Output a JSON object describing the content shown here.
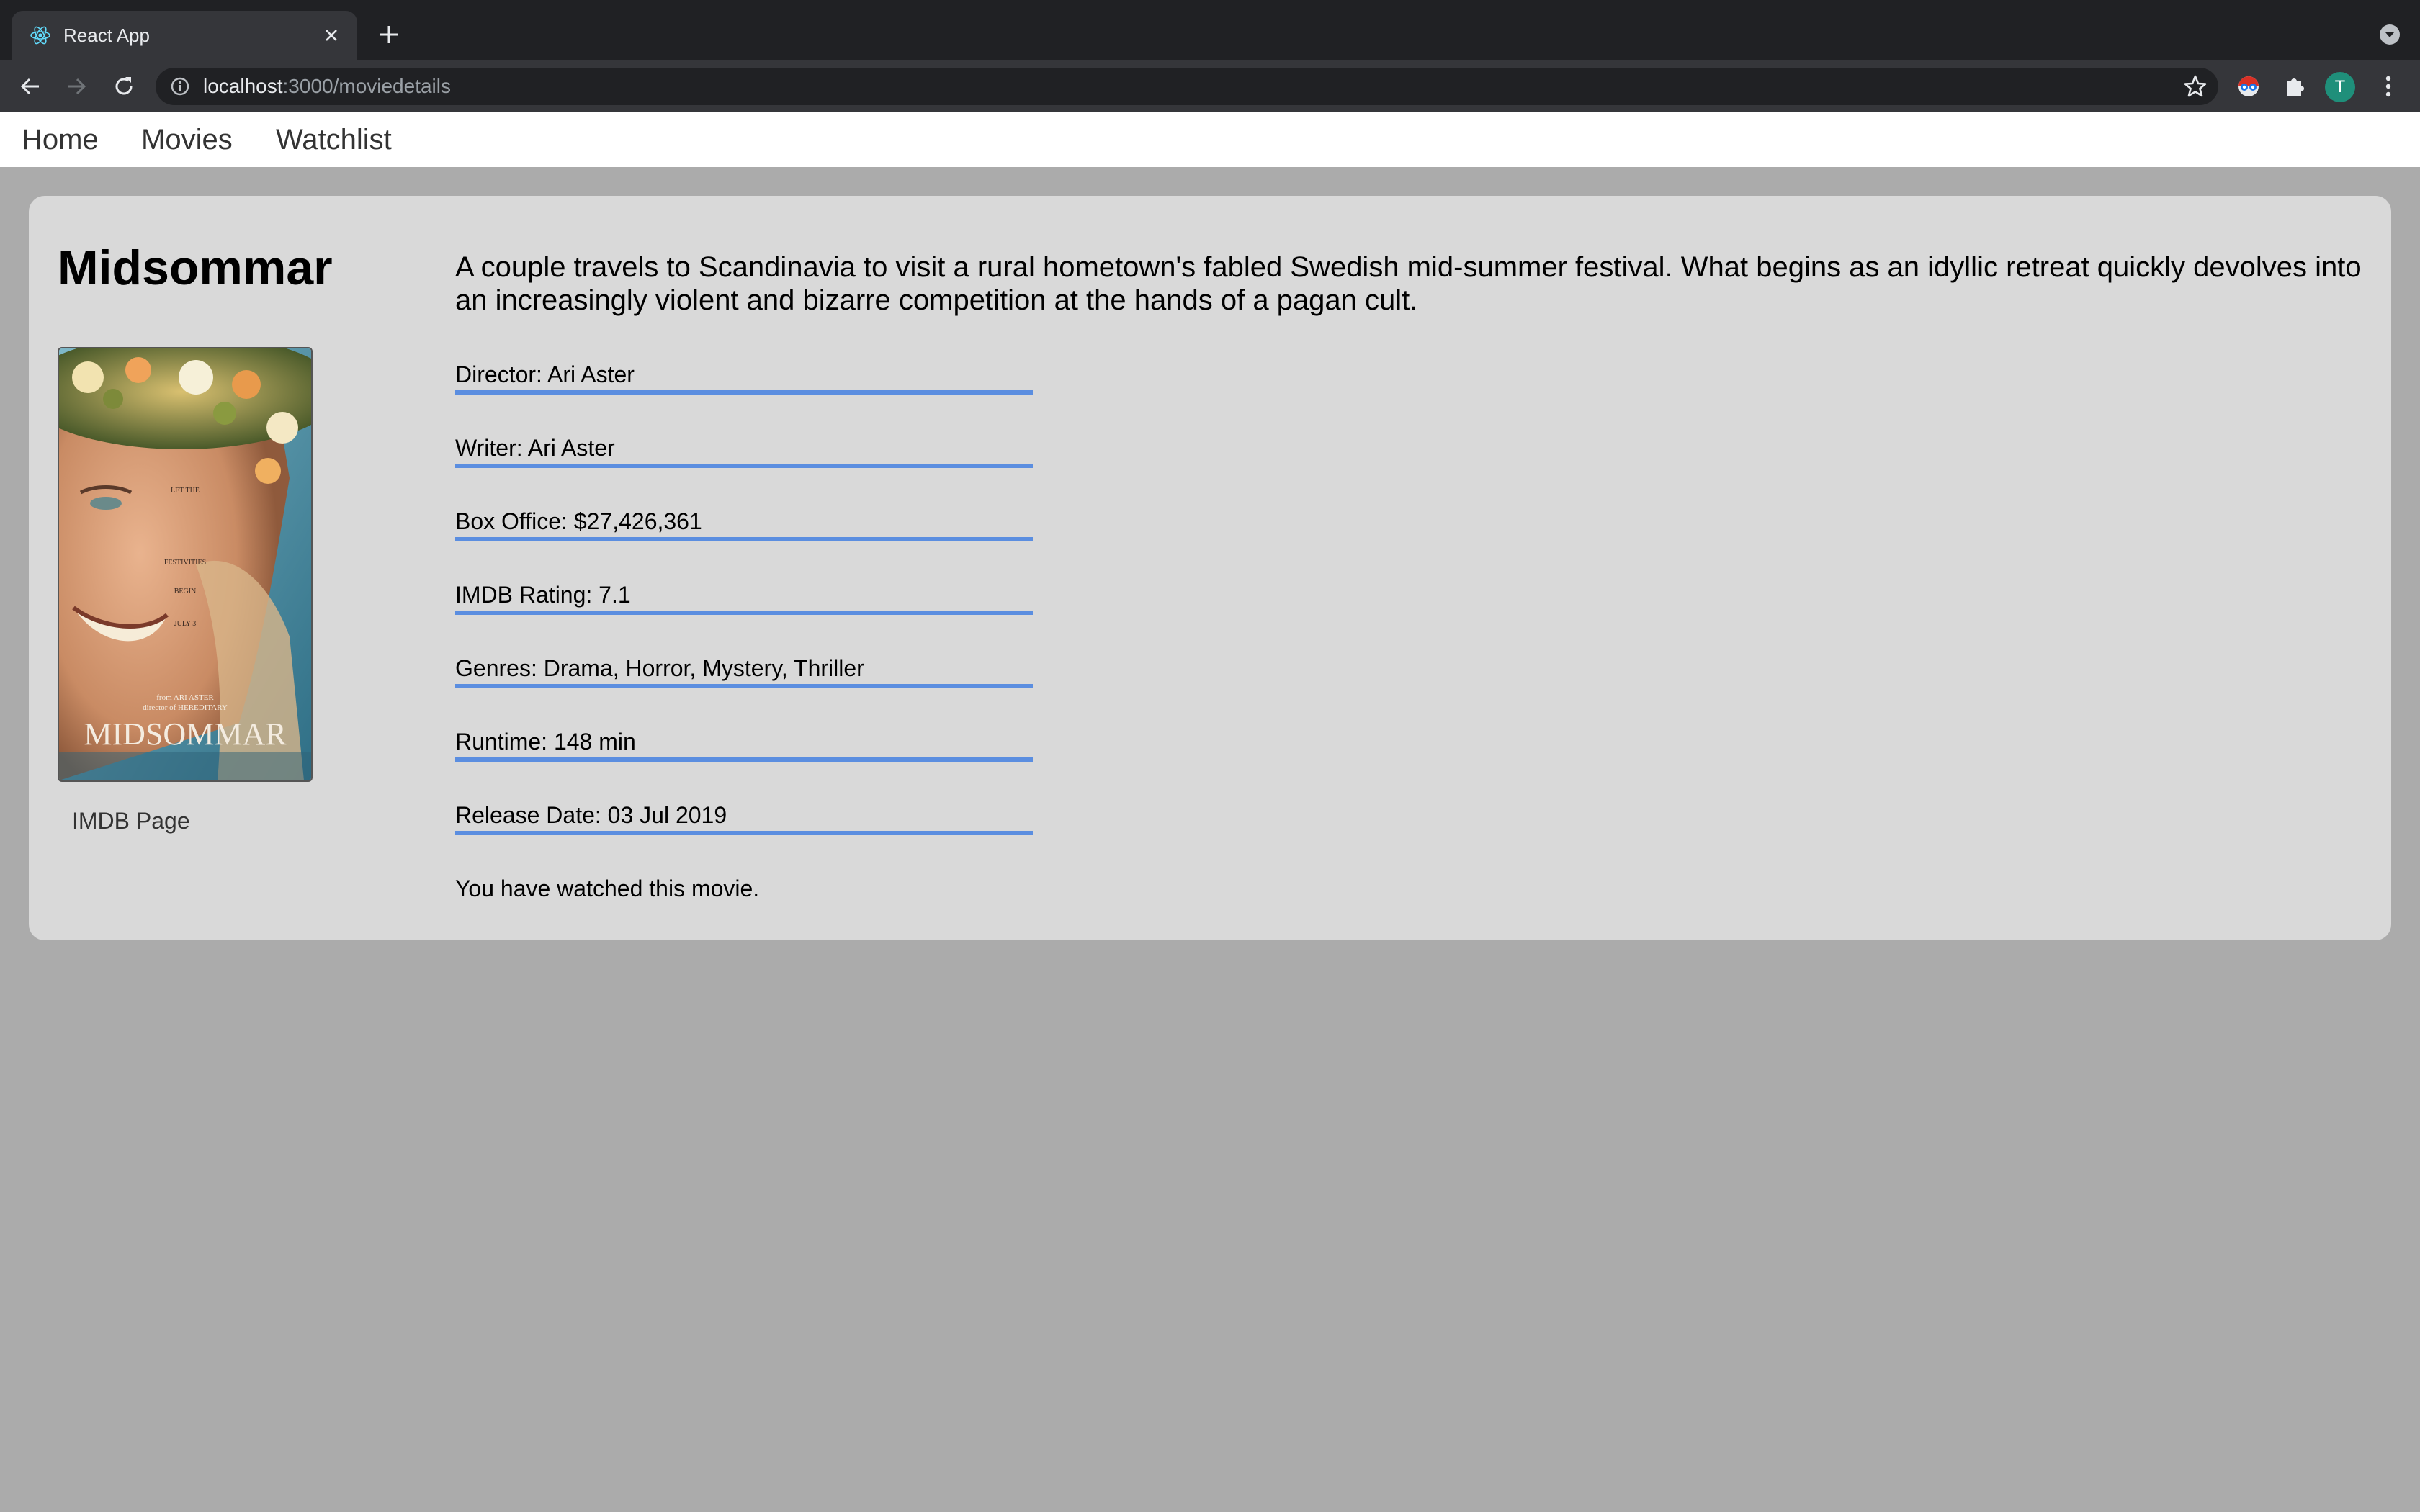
{
  "browser": {
    "tab_title": "React App",
    "url_host": "localhost",
    "url_path": ":3000/moviedetails",
    "profile_initial": "T"
  },
  "nav": {
    "items": [
      {
        "label": "Home"
      },
      {
        "label": "Movies"
      },
      {
        "label": "Watchlist"
      }
    ]
  },
  "movie": {
    "title": "Midsommar",
    "plot": "A couple travels to Scandinavia to visit a rural hometown's fabled Swedish mid-summer festival. What begins as an idyllic retreat quickly devolves into an increasingly violent and bizarre competition at the hands of a pagan cult.",
    "details": [
      {
        "text": "Director: Ari Aster"
      },
      {
        "text": "Writer: Ari Aster"
      },
      {
        "text": "Box Office: $27,426,361"
      },
      {
        "text": "IMDB Rating: 7.1"
      },
      {
        "text": "Genres: Drama, Horror, Mystery, Thriller"
      },
      {
        "text": "Runtime: 148 min"
      },
      {
        "text": "Release Date: 03 Jul 2019"
      }
    ],
    "imdb_link_label": "IMDB Page",
    "watched_status": "You have watched this movie.",
    "poster": {
      "title_text": "MIDSOMMAR",
      "credit_line1": "from ARI ASTER",
      "credit_line2": "director of HEREDITARY",
      "tagline_lines": [
        "LET THE",
        "FESTIVITIES",
        "BEGIN",
        "JULY 3"
      ]
    }
  },
  "colors": {
    "page_bg": "#ababab",
    "card_bg": "#d9d9d9",
    "underline": "#5b8ee0"
  }
}
